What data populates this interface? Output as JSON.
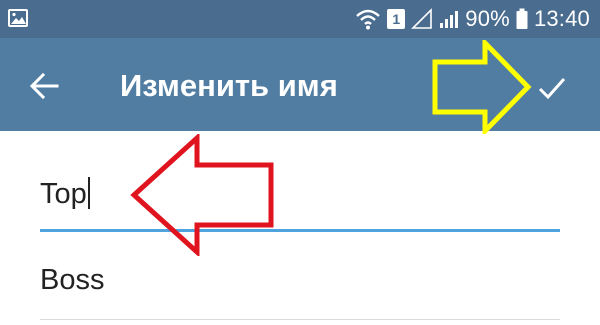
{
  "status_bar": {
    "battery_level": "90%",
    "time": "13:40",
    "sim_badge": "1",
    "icons": [
      "gallery-icon",
      "wifi-icon",
      "sim-icon",
      "signal-icon",
      "battery-icon"
    ]
  },
  "toolbar": {
    "title": "Изменить имя",
    "back_icon": "arrow-left-icon",
    "done_icon": "checkmark-icon"
  },
  "form": {
    "first_name": {
      "value": "Top"
    },
    "last_name": {
      "value": "Boss"
    }
  },
  "annotations": {
    "yellow_arrow_color": "#ffff00",
    "red_arrow_color": "#e0141e"
  },
  "colors": {
    "status_bar": "#4a6c8f",
    "toolbar": "#517da2",
    "accent_underline": "#4fa3de"
  }
}
